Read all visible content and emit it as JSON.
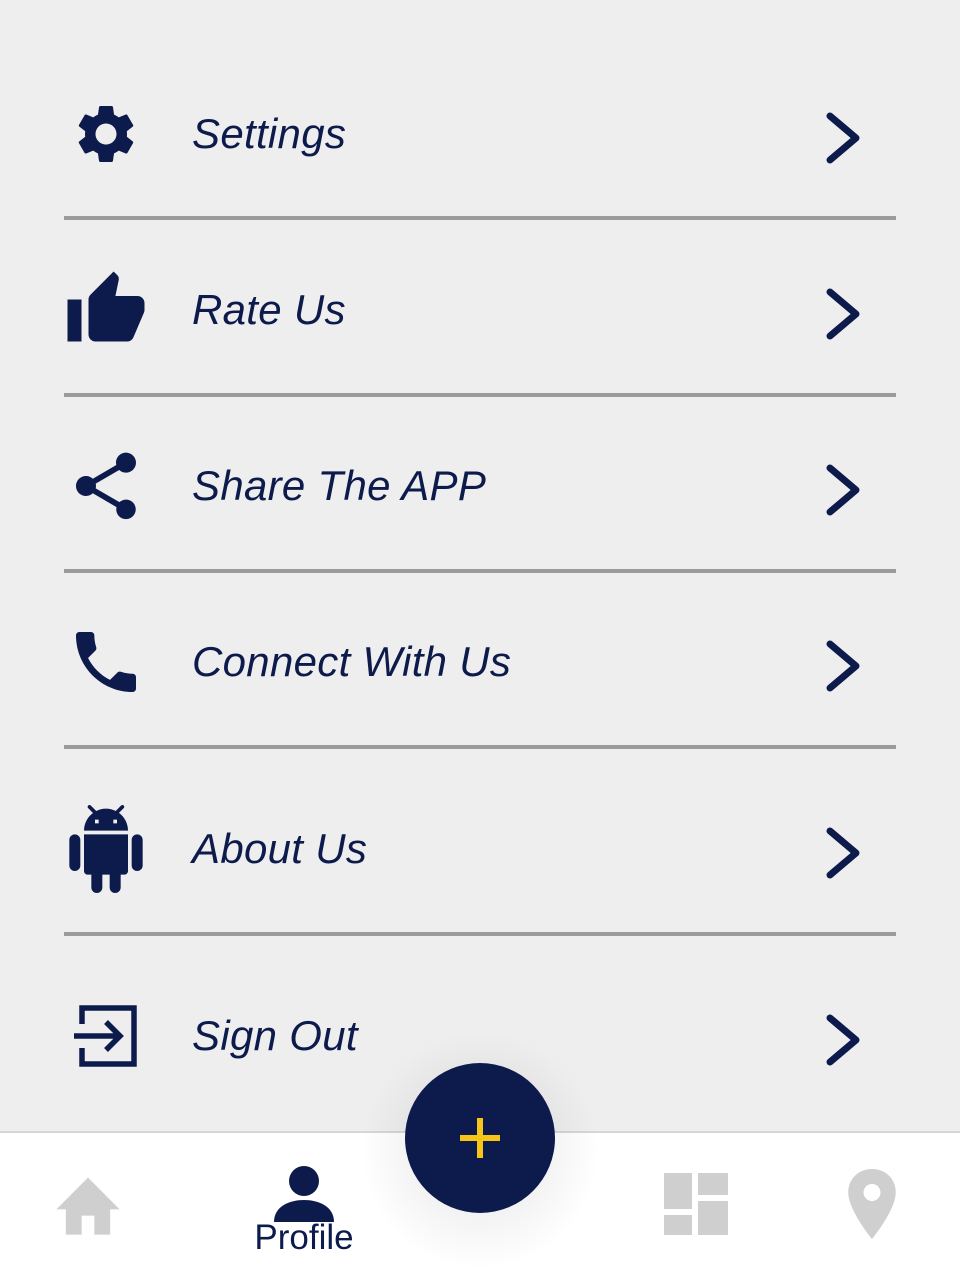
{
  "menu": {
    "items": [
      {
        "label": "Settings",
        "icon": "gear-icon"
      },
      {
        "label": "Rate Us",
        "icon": "thumbs-up-icon"
      },
      {
        "label": "Share The APP",
        "icon": "share-icon"
      },
      {
        "label": "Connect With Us",
        "icon": "phone-icon"
      },
      {
        "label": "About Us",
        "icon": "android-icon"
      },
      {
        "label": "Sign Out",
        "icon": "sign-out-icon"
      }
    ],
    "chevron_icon": "chevron-right-icon"
  },
  "bottom_nav": {
    "items": [
      {
        "name": "home",
        "icon": "home-icon",
        "label": ""
      },
      {
        "name": "profile",
        "icon": "person-icon",
        "label": "Profile",
        "active": true
      },
      {
        "name": "dashboard",
        "icon": "dashboard-icon",
        "label": ""
      },
      {
        "name": "location",
        "icon": "location-pin-icon",
        "label": ""
      }
    ],
    "fab_icon": "plus-icon"
  },
  "colors": {
    "primary": "#0d1b4c",
    "accent": "#f5c518",
    "background": "#efeeef",
    "divider": "#9b9b9b",
    "inactive": "#cfcfcf"
  }
}
